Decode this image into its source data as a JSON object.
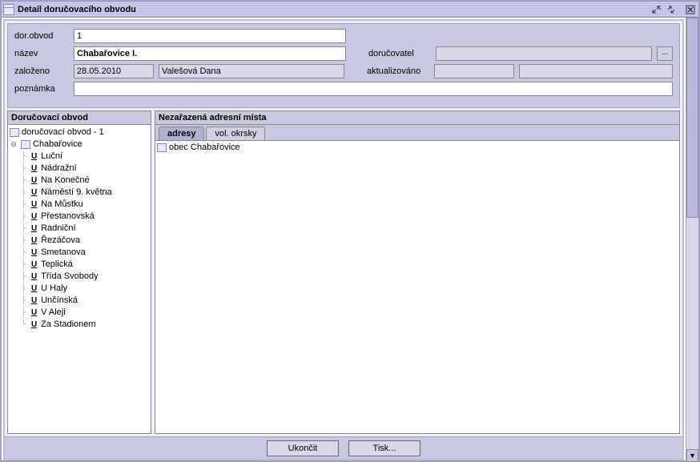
{
  "window": {
    "title": "Detail doručovacího obvodu"
  },
  "form": {
    "dor_obvod_label": "dor.obvod",
    "dor_obvod_value": "1",
    "nazev_label": "název",
    "nazev_value": "Chabařovice I.",
    "dorucovatel_label": "doručovatel",
    "dorucovatel_value": "",
    "zalozeno_label": "založeno",
    "zalozeno_date": "28.05.2010",
    "zalozeno_user": "Valešová Dana",
    "aktualizovano_label": "aktualizováno",
    "aktualizovano_date": "",
    "aktualizovano_user": "",
    "poznamka_label": "poznámka",
    "poznamka_value": ""
  },
  "left_panel": {
    "title": "Doručovací obvod",
    "root": "doručovací obvod - 1",
    "node": "Chabařovice",
    "streets": [
      "Luční",
      "Nádražní",
      "Na Konečné",
      "Náměstí 9. května",
      "Na Můstku",
      "Přestanovská",
      "Radniční",
      "Řezáčova",
      "Smetanova",
      "Teplická",
      "Třída Svobody",
      "U Haly",
      "Unčínská",
      "V Aleji",
      "Za Stadionem"
    ]
  },
  "right_panel": {
    "title": "Nezařazená adresní místa",
    "tabs": [
      "adresy",
      "vol. okrsky"
    ],
    "active_tab": 0,
    "item": "obec Chabařovice"
  },
  "buttons": {
    "ukoncit": "Ukončit",
    "tisk": "Tisk..."
  }
}
